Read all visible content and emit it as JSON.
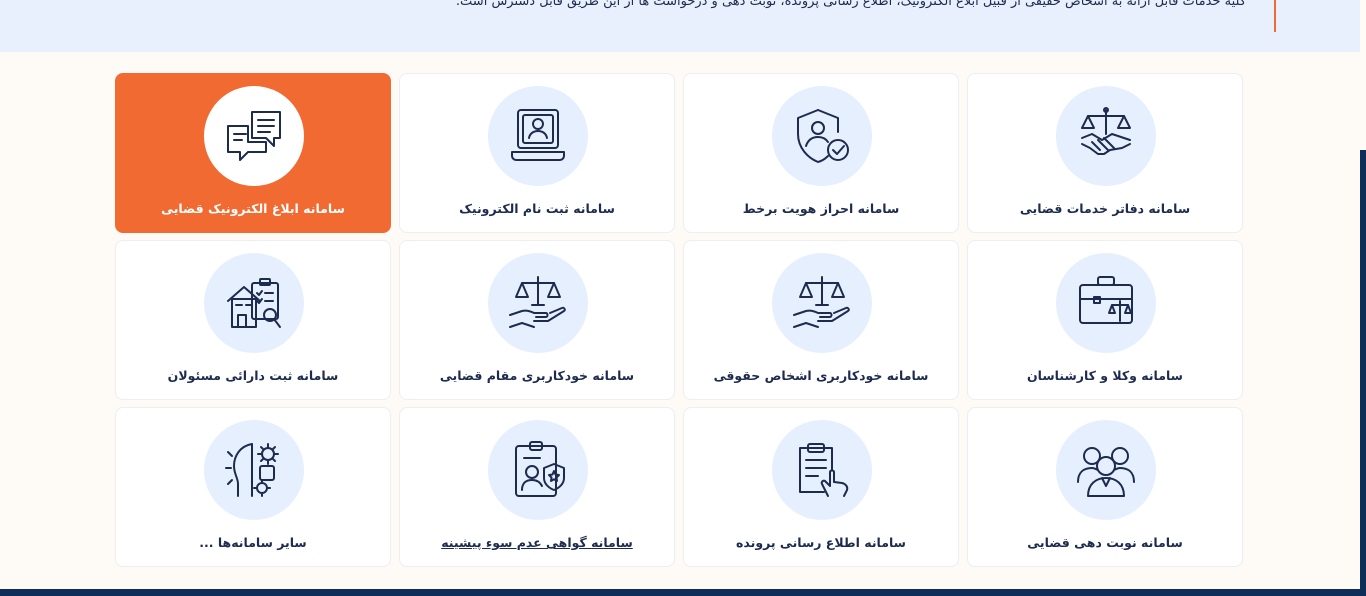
{
  "banner": {
    "text": "کلیه خدمات قابل ارائه به اشخاص حقیقی از قبیل ابلاغ الکترونیک، اطلاع رسانی پرونده، نوبت دهی و درخواست ها از این طریق قابل دسترس است."
  },
  "cards": [
    {
      "label": "سامانه دفاتر خدمات قضایی",
      "icon": "handshake-scales-icon"
    },
    {
      "label": "سامانه احراز هویت برخط",
      "icon": "shield-user-icon"
    },
    {
      "label": "سامانه ثبت نام الکترونیک",
      "icon": "laptop-user-icon"
    },
    {
      "label": "سامانه ابلاغ الکترونیک قضایی",
      "icon": "chat-bubbles-icon"
    },
    {
      "label": "سامانه وکلا و کارشناسان",
      "icon": "briefcase-scales-icon"
    },
    {
      "label": "سامانه خودکاربری اشخاص حقوقی",
      "icon": "hand-scales-icon"
    },
    {
      "label": "سامانه خودکاربری مقام قضایی",
      "icon": "hand-scales-icon"
    },
    {
      "label": "سامانه ثبت دارائی مسئولان",
      "icon": "building-clipboard-icon"
    },
    {
      "label": "سامانه نوبت دهی قضایی",
      "icon": "people-group-icon"
    },
    {
      "label": "سامانه اطلاع رسانی پرونده",
      "icon": "clipboard-touch-icon"
    },
    {
      "label": "سامانه گواهی عدم سوء پیشینه",
      "icon": "id-badge-icon"
    },
    {
      "label": "سایر سامانه‌ها ...",
      "icon": "gears-head-icon"
    }
  ]
}
